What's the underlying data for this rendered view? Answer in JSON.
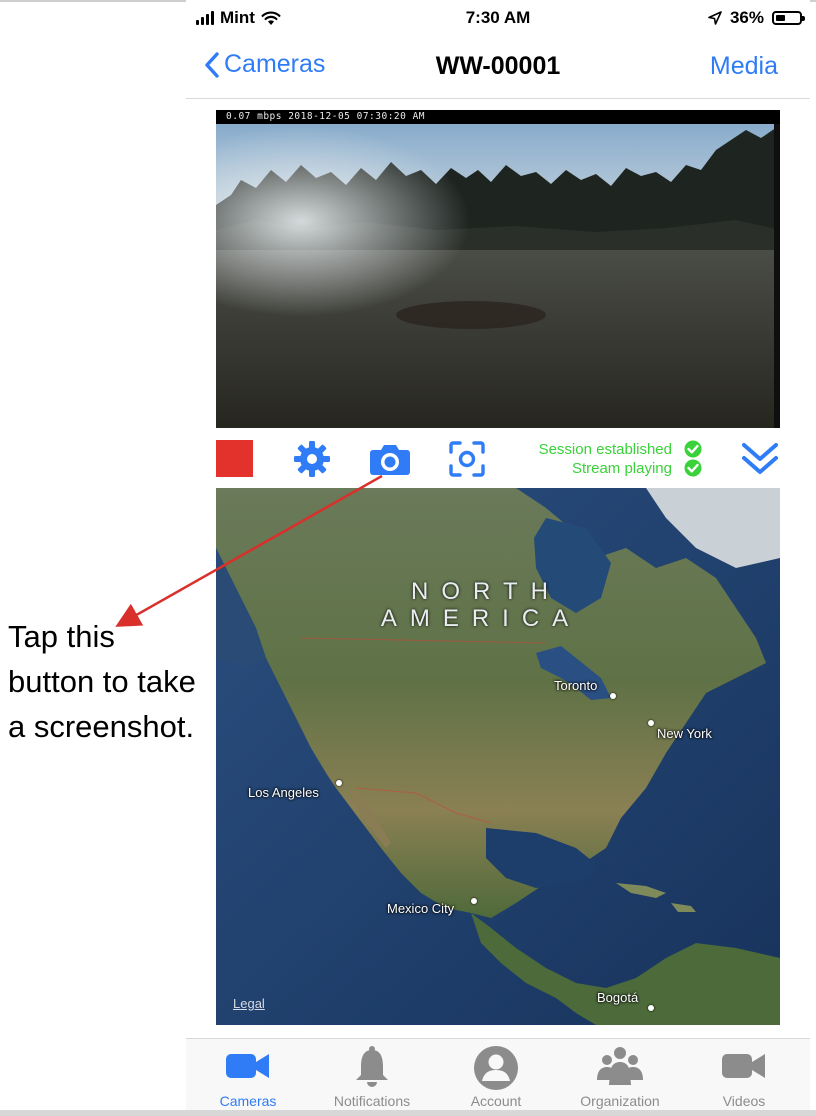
{
  "status_bar": {
    "carrier": "Mint",
    "time": "7:30 AM",
    "battery": "36%"
  },
  "nav": {
    "back_label": "Cameras",
    "title": "WW-00001",
    "media_label": "Media"
  },
  "video": {
    "overlay_text": "0.07 mbps 2018-12-05 07:30:20 AM"
  },
  "controls": {
    "stop_icon": "stop-square-icon",
    "settings_icon": "gear-icon",
    "camera_icon": "camera-icon",
    "scan_icon": "scan-frame-icon",
    "expand_icon": "double-chevron-down-icon",
    "session_status": "Session established",
    "stream_status": "Stream playing",
    "status_color": "#3ad13a",
    "stop_color": "#e3312b",
    "accent_color": "#2f7cf6"
  },
  "map": {
    "continent_line1": "NORTH",
    "continent_line2": "AMERICA",
    "cities": {
      "toronto": "Toronto",
      "new_york": "New York",
      "los_angeles": "Los Angeles",
      "mexico_city": "Mexico City",
      "bogota": "Bogotá"
    },
    "legal": "Legal"
  },
  "tabs": [
    {
      "label": "Cameras",
      "icon": "video-camera-icon",
      "active": true
    },
    {
      "label": "Notifications",
      "icon": "bell-icon",
      "active": false
    },
    {
      "label": "Account",
      "icon": "person-icon",
      "active": false
    },
    {
      "label": "Organization",
      "icon": "group-icon",
      "active": false
    },
    {
      "label": "Videos",
      "icon": "video-camera-icon",
      "active": false
    }
  ],
  "annotation": {
    "text": "Tap this button to take a screenshot.",
    "arrow_color": "#d9302b"
  }
}
